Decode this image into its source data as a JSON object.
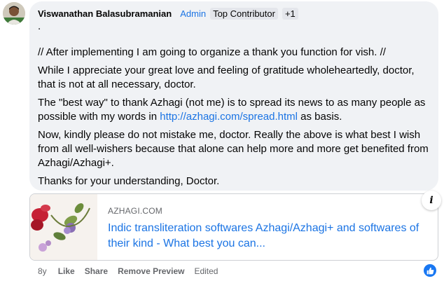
{
  "comment": {
    "author": "Viswanathan Balasubramanian",
    "badges": [
      "Admin",
      "Top Contributor",
      "+1"
    ],
    "dot": ".",
    "paragraphs": {
      "p1": "// After implementing I am going to organize a thank you function for vish. //",
      "p2": "While I appreciate your great love and feeling of gratitude wholeheartedly, doctor, that is not at all necessary, doctor.",
      "p3_before": "The \"best way\" to thank Azhagi (not me) is to spread its news to as many people as possible with my words in ",
      "p3_link": "http://azhagi.com/spread.html",
      "p3_after": " as basis.",
      "p4": "Now, kindly please do not mistake me, doctor. Really the above is what best I wish from all well-wishers because that alone can help more and more get benefited from Azhagi/Azhagi+.",
      "p5": "Thanks for your understanding, Doctor."
    }
  },
  "preview": {
    "domain": "AZHAGI.COM",
    "title": "Indic transliteration softwares Azhagi/Azhagi+ and softwares of their kind - What best you can..."
  },
  "actions": {
    "time": "8y",
    "like": "Like",
    "share": "Share",
    "remove_preview": "Remove Preview",
    "edited": "Edited"
  },
  "icons": {
    "info": "info-icon",
    "like_reaction": "thumbs-up-icon"
  },
  "colors": {
    "link": "#1b74e4",
    "bubble": "#f0f2f5",
    "like_badge": "#1877f2"
  }
}
